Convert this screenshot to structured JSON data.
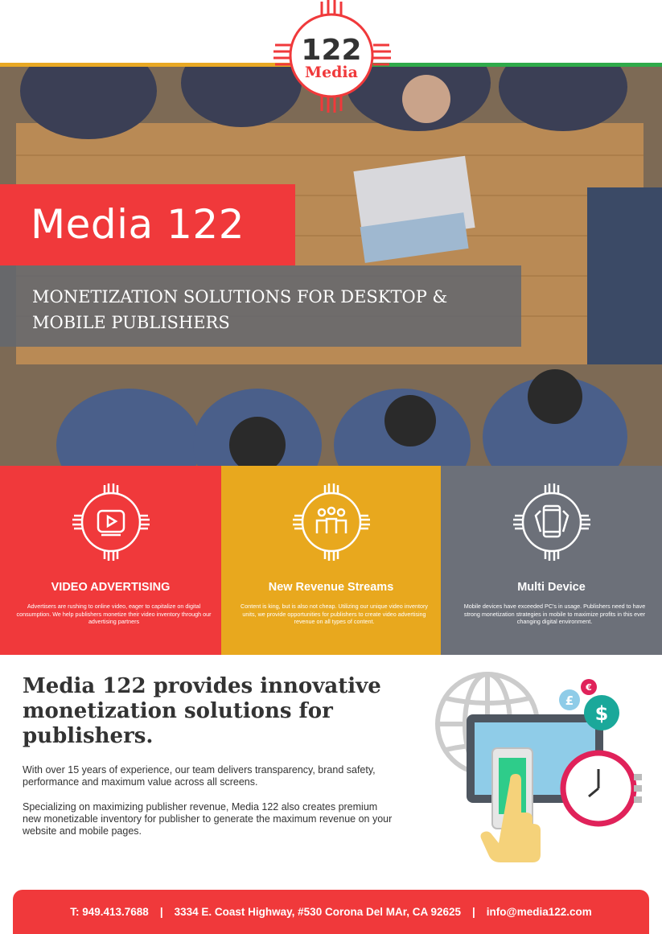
{
  "logo": {
    "number": "122",
    "word": "Media"
  },
  "hero": {
    "title": "Media 122",
    "subtitle": "MONETIZATION SOLUTIONS FOR DESKTOP & MOBILE PUBLISHERS"
  },
  "features": [
    {
      "heading": "VIDEO ADVERTISING",
      "text": "Advertisers are rushing to online video, eager to capitalize on digital consumption. We help publishers monetize their video inventory through our advertising partners",
      "icon": "video-play-icon"
    },
    {
      "heading": "New Revenue Streams",
      "text": "Content is king, but is also not cheap. Utilizing our unique video inventory units, we provide opportunities for publishers to create video advertising revenue on all types of content.",
      "icon": "audience-icon"
    },
    {
      "heading": "Multi Device",
      "text": "Mobile devices have exceeded PC's in usage. Publishers need to have strong monetization strategies in mobile to maximize profits in this ever changing digital environment.",
      "icon": "mobile-device-icon"
    }
  ],
  "body": {
    "headline": "Media 122 provides innovative monetization solutions for publishers.",
    "para1": "With over 15 years of experience, our team delivers transparency, brand safety, performance and maximum value across all screens.",
    "para2": "Specializing on maximizing publisher revenue, Media 122 also creates premium new monetizable inventory for publisher to generate the maximum revenue on your website and mobile pages."
  },
  "illustration": {
    "euro": "€",
    "pound": "£",
    "dollar": "$"
  },
  "footer": {
    "phone": "T: 949.413.7688",
    "sep": "|",
    "address": "3334 E. Coast Highway, #530 Corona Del MAr, CA 92625",
    "email": "info@media122.com"
  },
  "colors": {
    "red": "#f0393b",
    "yellow": "#e8a81e",
    "gray": "#6c7079",
    "green": "#2faa4a"
  }
}
